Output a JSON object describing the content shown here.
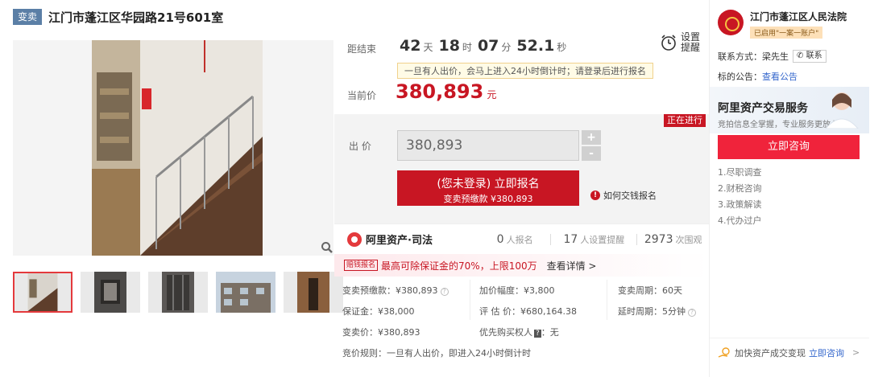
{
  "title": {
    "tag": "变卖",
    "text": "江门市蓬江区华园路21号601室"
  },
  "countdown": {
    "label": "距结束",
    "days": "42",
    "days_unit": "天",
    "hours": "18",
    "hours_unit": "时",
    "minutes": "07",
    "minutes_unit": "分",
    "seconds": "52.1",
    "seconds_unit": "秒"
  },
  "reminder": {
    "line1": "设置",
    "line2": "提醒"
  },
  "notice_bar": "一旦有人出价，会马上进入24小时倒计时；请登录后进行报名",
  "current_price": {
    "label": "当前价",
    "value": "380,893",
    "unit": "元"
  },
  "bid": {
    "status": "正在进行",
    "label": "出 价",
    "input_value": "380,893",
    "plus": "+",
    "minus": "-",
    "signup_line1": "(您未登录) 立即报名",
    "signup_line2": "变卖预缴款 ¥380,893",
    "howto": "如何交钱报名",
    "howto_icon": "!"
  },
  "stats": {
    "brand": "阿里资产·司法",
    "signups_n": "0",
    "signups_t": "人报名",
    "reminders_n": "17",
    "reminders_t": "人设置提醒",
    "views_n": "2973",
    "views_t": "次围观"
  },
  "promo": {
    "tag": "赔钱报名",
    "text": "最高可除保证金的70%，上限100万",
    "link": "查看详情 >"
  },
  "info": {
    "prepay": "变卖预缴款：¥380,893",
    "increment": "加价幅度：¥3,800",
    "period": "变卖周期：60天",
    "deposit": "保证金：¥38,000",
    "valuation": "评 估 价：¥680,164.38",
    "delay": "延时周期：5分钟",
    "sale_price": "变卖价：¥380,893",
    "priority": "优先购买权人",
    "priority_tag": "?",
    "priority_value": "：无",
    "rule": "竞价规则：一旦有人出价，即进入24小时倒计时"
  },
  "court": {
    "name": "江门市蓬江区人民法院",
    "badge": "已启用\"一案一账户\"",
    "contact_label": "联系方式：梁先生",
    "contact_btn": "联系",
    "notice_label": "标的公告：",
    "notice_link": "查看公告"
  },
  "service": {
    "title": "阿里资产交易服务",
    "subtitle": "竞拍信息全掌握，专业服务更放心",
    "consult_btn": "立即咨询",
    "items": [
      "1.尽职调查",
      "2.财税咨询",
      "3.政策解读",
      "4.代办过户"
    ]
  },
  "bottom": {
    "text": "加快资产成交变现",
    "link": "立即咨询",
    "chev": ">"
  }
}
